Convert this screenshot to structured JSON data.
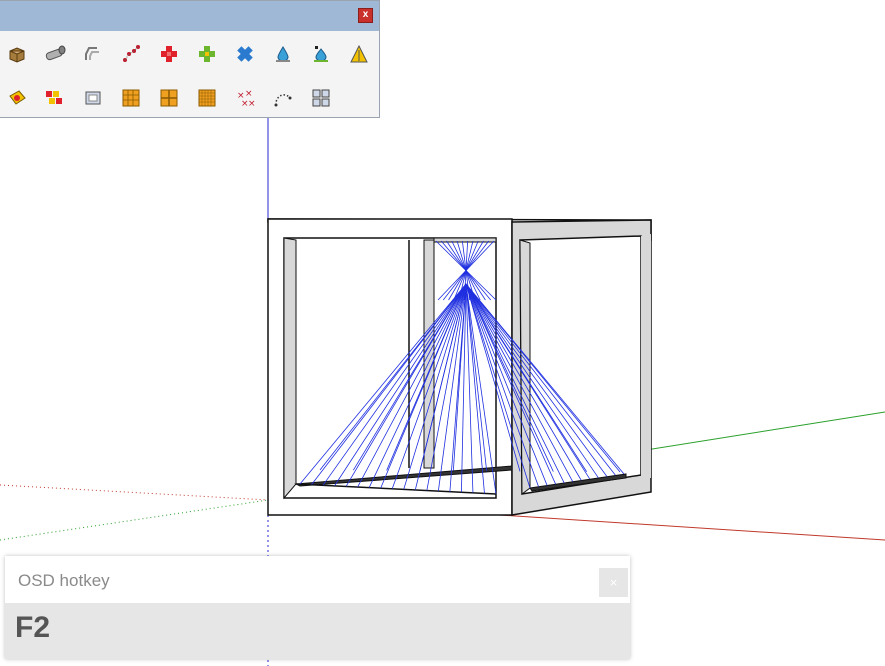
{
  "toolbar": {
    "close_label": "x",
    "row1_icons": [
      "cube-icon",
      "pipe-icon",
      "offset-icon",
      "points-icon",
      "add-red-icon",
      "add-green-icon",
      "multiply-icon",
      "drop-icon",
      "water-icon",
      "warning-icon"
    ],
    "row2_icons": [
      "stamp-icon",
      "groups-icon",
      "frame-icon",
      "grid-large-icon",
      "grid-cross-icon",
      "grid-fine-icon",
      "scatter-icon",
      "arc-points-icon",
      "components-icon"
    ]
  },
  "osd": {
    "title": "OSD hotkey",
    "close_label": "×",
    "key": "F2"
  },
  "colors": {
    "axis_red": "#c0392b",
    "axis_green": "#2aa02a",
    "axis_blue": "#2a2ad0",
    "strings": "#1f2fe0"
  }
}
